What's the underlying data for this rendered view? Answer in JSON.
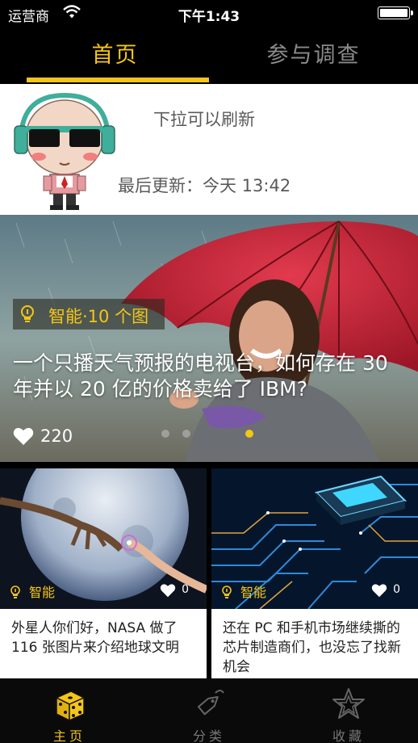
{
  "status_bar": {
    "carrier": "运营商",
    "time": "下午1:43"
  },
  "top_tabs": [
    {
      "label": "首页",
      "active": true
    },
    {
      "label": "参与调查",
      "active": false
    }
  ],
  "refresh": {
    "pull_text": "下拉可以刷新",
    "last_updated": "最后更新：今天 13:42"
  },
  "hero": {
    "tag": "智能·10 个图",
    "title": "一个只播天气预报的电视台，如何存在 30 年并以 20 亿的价格卖给了 IBM?",
    "likes": "220",
    "page_count": 3,
    "active_page": 3
  },
  "cards": [
    {
      "category": "智能",
      "likes": "0",
      "title": "外星人你们好，NASA 做了 116 张图片来介绍地球文明"
    },
    {
      "category": "智能",
      "likes": "0",
      "title": "还在 PC 和手机市场继续撕的芯片制造商们，也没忘了找新机会"
    }
  ],
  "tab_bar": [
    {
      "label": "主页",
      "icon": "dice-icon",
      "active": true
    },
    {
      "label": "分类",
      "icon": "tag-icon",
      "active": false
    },
    {
      "label": "收藏",
      "icon": "star-icon",
      "active": false
    }
  ],
  "colors": {
    "accent": "#f5c518",
    "background": "#000000",
    "inactive": "#8a8a8a"
  }
}
